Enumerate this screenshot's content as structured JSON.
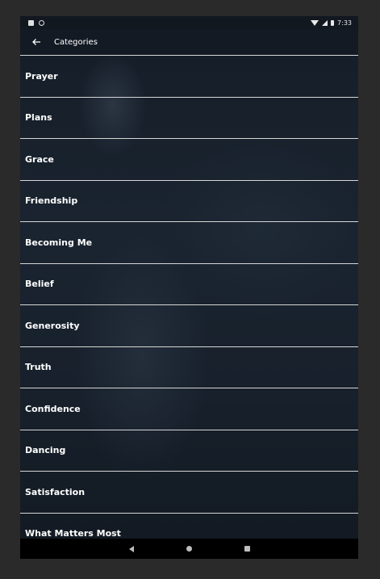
{
  "status_bar": {
    "time": "7:33",
    "left_icons": [
      "notification-icon",
      "sync-icon"
    ],
    "right_icons": [
      "wifi-icon",
      "signal-icon",
      "battery-icon"
    ]
  },
  "app_bar": {
    "back_icon": "arrow-left-icon",
    "title": "Categories"
  },
  "categories": [
    {
      "label": "Prayer"
    },
    {
      "label": "Plans"
    },
    {
      "label": "Grace"
    },
    {
      "label": "Friendship"
    },
    {
      "label": "Becoming Me"
    },
    {
      "label": "Belief"
    },
    {
      "label": "Generosity"
    },
    {
      "label": "Truth"
    },
    {
      "label": "Confidence"
    },
    {
      "label": "Dancing"
    },
    {
      "label": "Satisfaction"
    },
    {
      "label": "What Matters Most"
    }
  ],
  "nav_bar": {
    "buttons": [
      "back-triangle-icon",
      "home-circle-icon",
      "recents-square-icon"
    ]
  }
}
